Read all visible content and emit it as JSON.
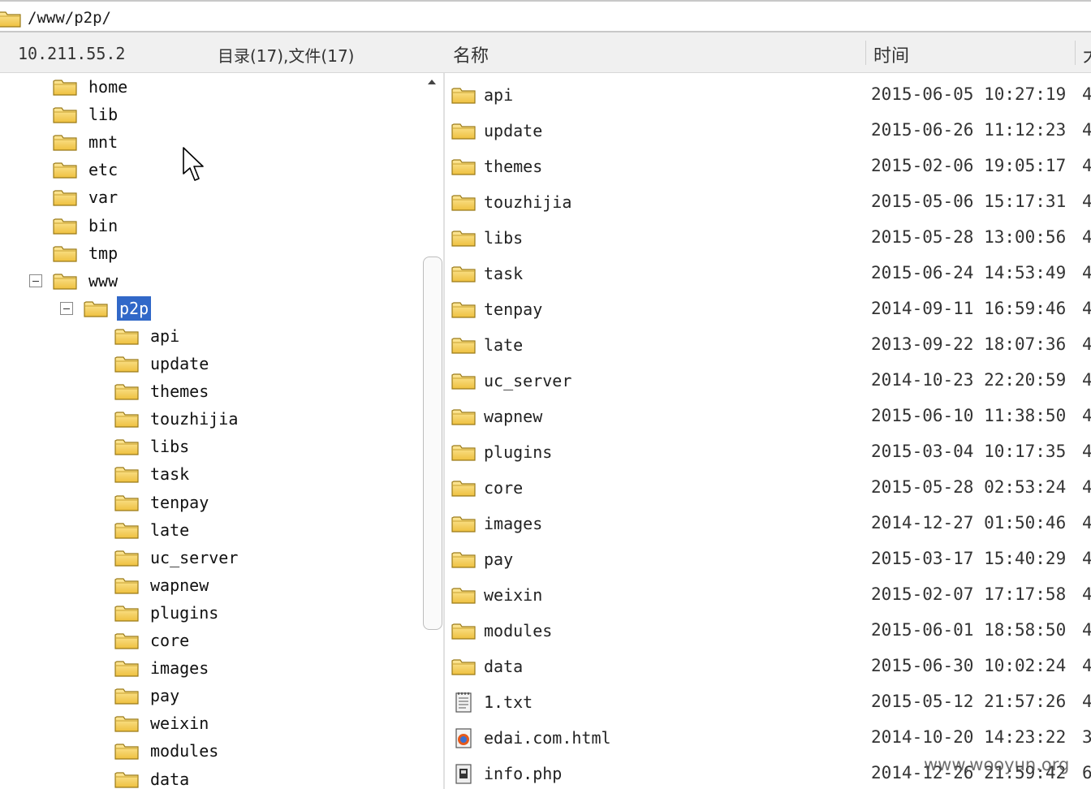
{
  "address": {
    "path": "/www/p2p/"
  },
  "left_header": {
    "host": "10.211.55.2",
    "summary": "目录(17),文件(17)"
  },
  "tree": {
    "top_items": [
      "home",
      "lib",
      "mnt",
      "etc",
      "var",
      "bin",
      "tmp"
    ],
    "www": "www",
    "selected": "p2p",
    "children": [
      "api",
      "update",
      "themes",
      "touzhijia",
      "libs",
      "task",
      "tenpay",
      "late",
      "uc_server",
      "wapnew",
      "plugins",
      "core",
      "images",
      "pay",
      "weixin",
      "modules",
      "data"
    ]
  },
  "columns": {
    "name": "名称",
    "time": "时间",
    "extra": "大"
  },
  "files": [
    {
      "name": "api",
      "time": "2015-06-05 10:27:19",
      "size": "4",
      "icon": "folder-icon"
    },
    {
      "name": "update",
      "time": "2015-06-26 11:12:23",
      "size": "4",
      "icon": "folder-icon"
    },
    {
      "name": "themes",
      "time": "2015-02-06 19:05:17",
      "size": "4",
      "icon": "folder-icon"
    },
    {
      "name": "touzhijia",
      "time": "2015-05-06 15:17:31",
      "size": "4",
      "icon": "folder-icon"
    },
    {
      "name": "libs",
      "time": "2015-05-28 13:00:56",
      "size": "4",
      "icon": "folder-icon"
    },
    {
      "name": "task",
      "time": "2015-06-24 14:53:49",
      "size": "4",
      "icon": "folder-icon"
    },
    {
      "name": "tenpay",
      "time": "2014-09-11 16:59:46",
      "size": "4",
      "icon": "folder-icon"
    },
    {
      "name": "late",
      "time": "2013-09-22 18:07:36",
      "size": "4",
      "icon": "folder-icon"
    },
    {
      "name": "uc_server",
      "time": "2014-10-23 22:20:59",
      "size": "4",
      "icon": "folder-icon"
    },
    {
      "name": "wapnew",
      "time": "2015-06-10 11:38:50",
      "size": "4",
      "icon": "folder-icon"
    },
    {
      "name": "plugins",
      "time": "2015-03-04 10:17:35",
      "size": "4",
      "icon": "folder-icon"
    },
    {
      "name": "core",
      "time": "2015-05-28 02:53:24",
      "size": "4",
      "icon": "folder-icon"
    },
    {
      "name": "images",
      "time": "2014-12-27 01:50:46",
      "size": "4",
      "icon": "folder-icon"
    },
    {
      "name": "pay",
      "time": "2015-03-17 15:40:29",
      "size": "4",
      "icon": "folder-icon"
    },
    {
      "name": "weixin",
      "time": "2015-02-07 17:17:58",
      "size": "4",
      "icon": "folder-icon"
    },
    {
      "name": "modules",
      "time": "2015-06-01 18:58:50",
      "size": "4",
      "icon": "folder-icon"
    },
    {
      "name": "data",
      "time": "2015-06-30 10:02:24",
      "size": "4",
      "icon": "folder-icon"
    },
    {
      "name": "1.txt",
      "time": "2015-05-12 21:57:26",
      "size": "4",
      "icon": "text-file-icon"
    },
    {
      "name": "edai.com.html",
      "time": "2014-10-20 14:23:22",
      "size": "3",
      "icon": "firefox-html-icon"
    },
    {
      "name": "info.php",
      "time": "2014-12-26 21:59:42",
      "size": "6",
      "icon": "php-file-icon"
    }
  ],
  "watermark": "www.wooyun.org",
  "colors": {
    "selection": "#3168c8",
    "header_bg": "#f0f0f0",
    "folder": "#f3c548"
  }
}
